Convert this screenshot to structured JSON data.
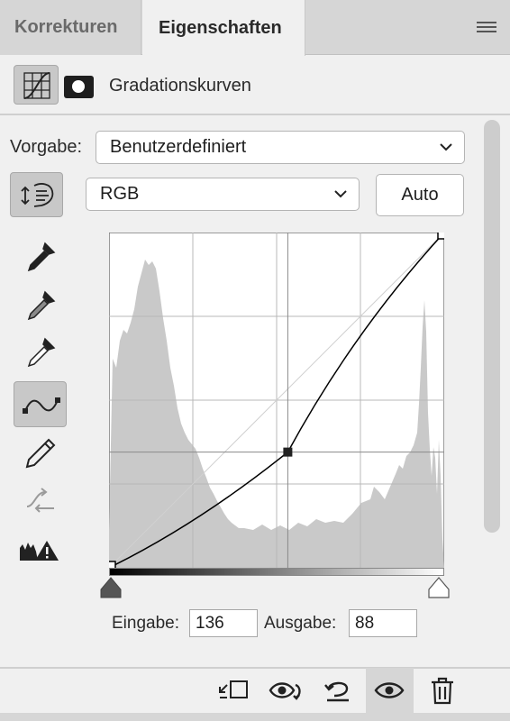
{
  "tabs": [
    {
      "label": "Korrekturen",
      "active": false
    },
    {
      "label": "Eigenschaften",
      "active": true
    }
  ],
  "header": {
    "title": "Gradationskurven"
  },
  "preset": {
    "label": "Vorgabe:",
    "value": "Benutzerdefiniert"
  },
  "channel": {
    "value": "RGB"
  },
  "auto_label": "Auto",
  "tools": [
    "on-image-adjust-icon",
    "black-point-eyedropper-icon",
    "gray-point-eyedropper-icon",
    "white-point-eyedropper-icon",
    "curve-points-icon",
    "pencil-draw-icon",
    "smooth-curve-icon",
    "clipping-warning-icon"
  ],
  "curve": {
    "input": 136,
    "output": 88
  },
  "io": {
    "input_label": "Eingabe:",
    "input_value": "136",
    "output_label": "Ausgabe:",
    "output_value": "88"
  },
  "footer_icons": [
    "clip-to-layer-icon",
    "view-previous-state-icon",
    "reset-icon",
    "visibility-eye-icon",
    "delete-trash-icon"
  ],
  "colors": {
    "panel_bg": "#f0f0f0",
    "tab_bg": "#d6d6d6",
    "histogram": "#c9c9c9",
    "curve": "#000000"
  }
}
